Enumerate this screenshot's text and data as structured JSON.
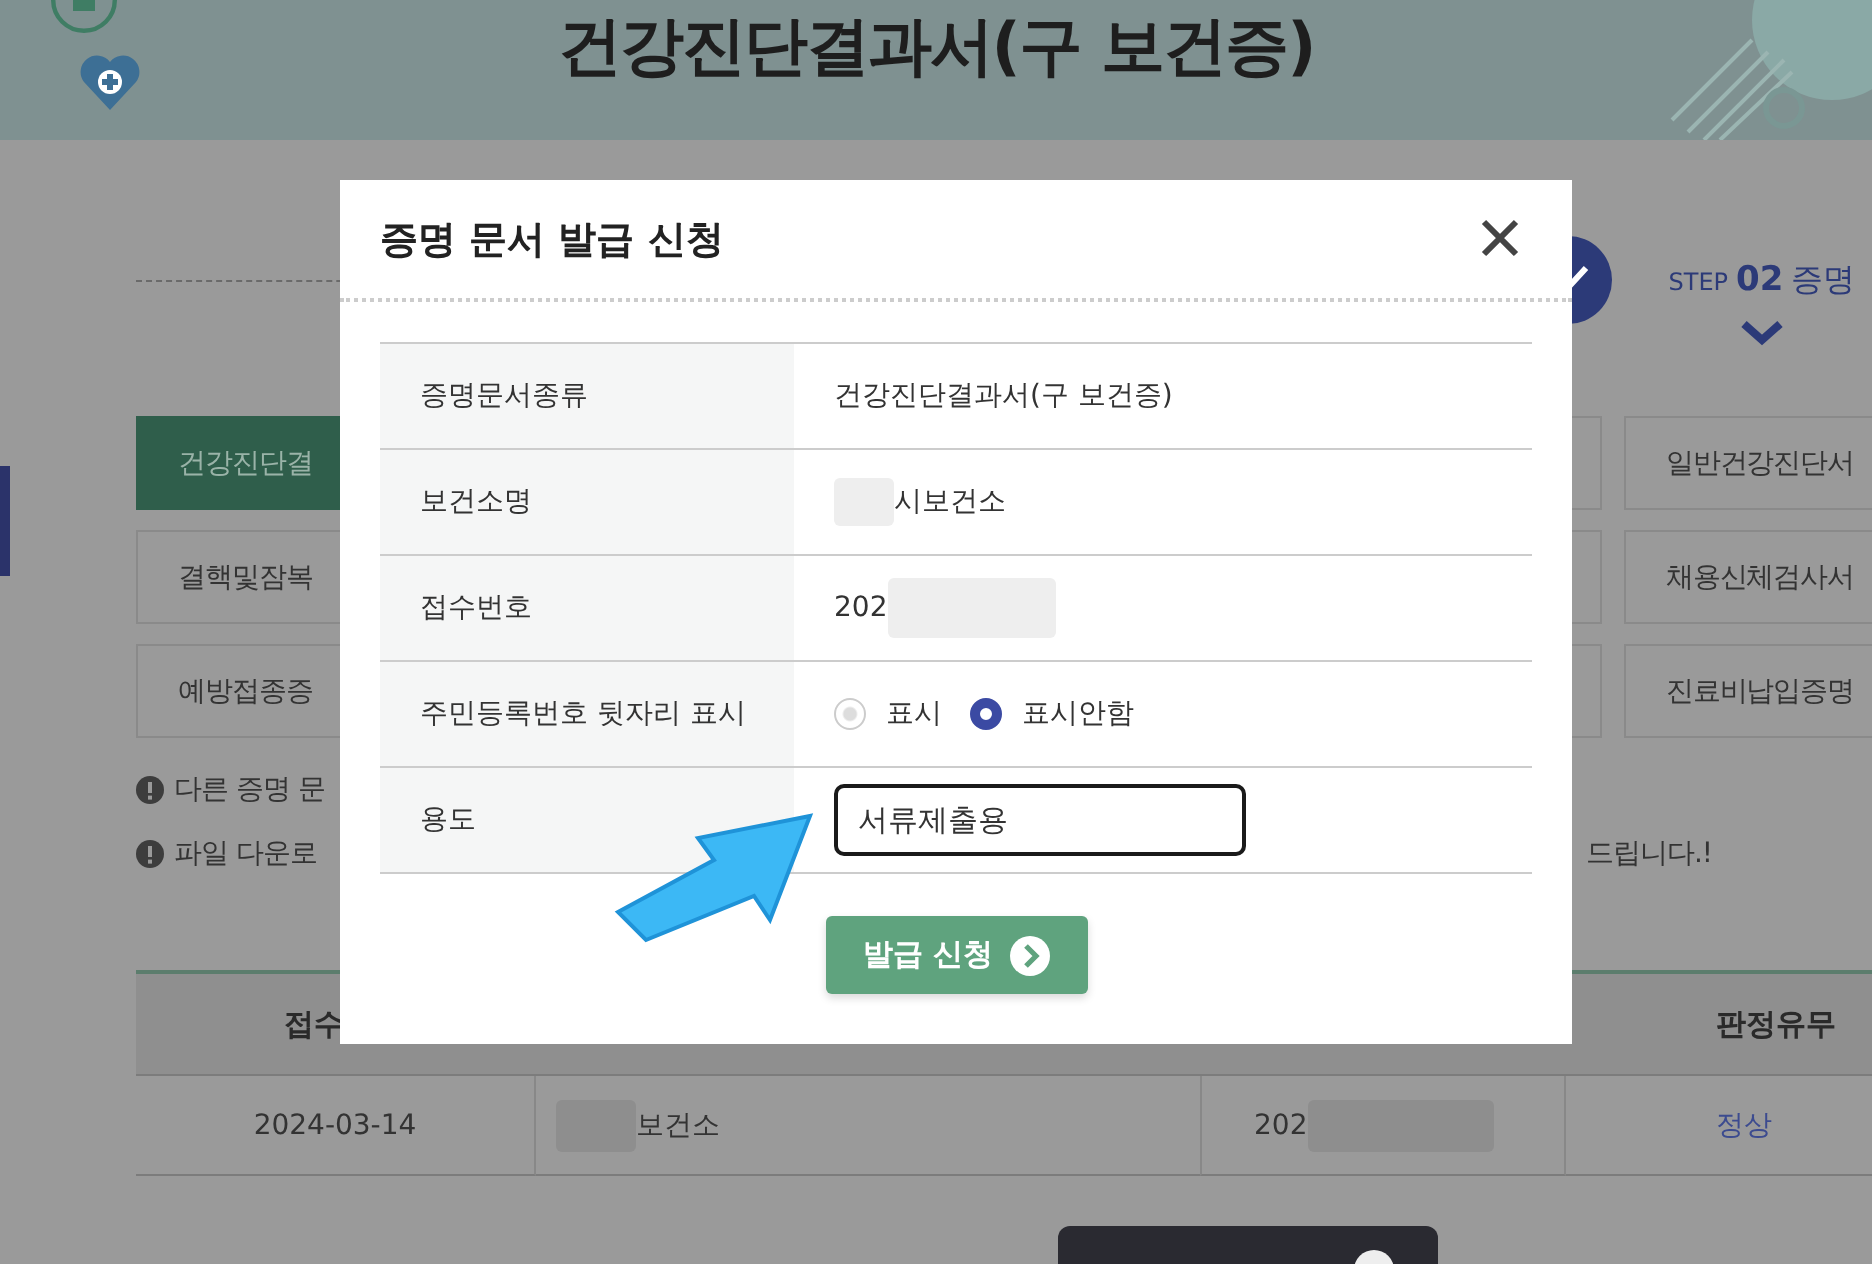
{
  "header": {
    "title": "건강진단결과서(구 보건증)"
  },
  "stepper": {
    "step_label": "STEP",
    "step_number": "02",
    "step_title": "증명"
  },
  "left_tabs": [
    {
      "label": "건강진단결",
      "selected": true
    },
    {
      "label": "결핵및잠복",
      "selected": false
    },
    {
      "label": "예방접종증",
      "selected": false
    }
  ],
  "right_tabs": [
    {
      "label": "일반건강진단서",
      "selected": false
    },
    {
      "label": "채용신체검사서",
      "selected": false
    },
    {
      "label": "진료비납입증명",
      "selected": false
    }
  ],
  "notices": [
    {
      "text": "다른 증명 문"
    },
    {
      "text": "파일 다운로",
      "tail": "드립니다.!"
    }
  ],
  "results_table": {
    "first_header": "접수",
    "last_header": "판정유무",
    "rows": [
      {
        "date": "2024-03-14",
        "clinic": "보건소",
        "receipt_no": "202",
        "judgement": "정상"
      }
    ]
  },
  "modal": {
    "title": "증명 문서 발급 신청",
    "rows": [
      {
        "kind": "text",
        "label": "증명문서종류",
        "value": "건강진단결과서(구 보건증)"
      },
      {
        "kind": "blur_before",
        "label": "보건소명",
        "value": "시보건소"
      },
      {
        "kind": "blur_after",
        "label": "접수번호",
        "value": "202"
      },
      {
        "kind": "radio",
        "label": "주민등록번호 뒷자리 표시",
        "options": [
          {
            "label": "표시",
            "selected": false
          },
          {
            "label": "표시안함",
            "selected": true
          }
        ]
      },
      {
        "kind": "input",
        "label": "용도",
        "value": "서류제출용"
      }
    ],
    "submit": "발급 신청"
  }
}
